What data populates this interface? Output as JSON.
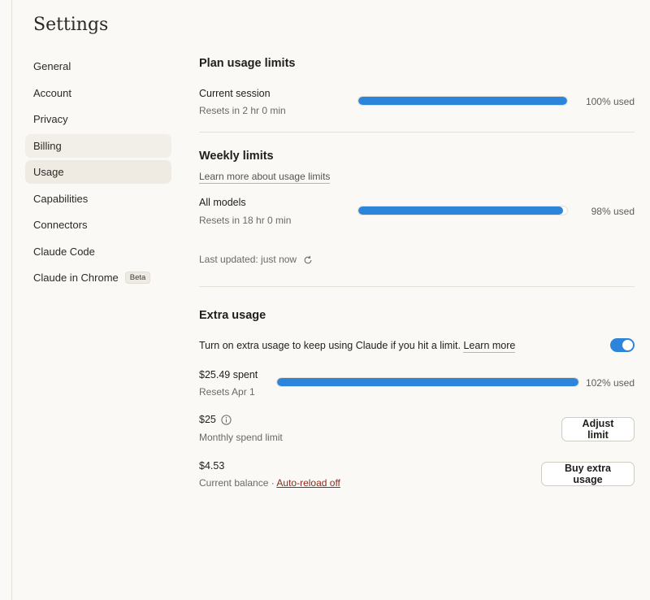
{
  "page": {
    "title": "Settings"
  },
  "sidebar": {
    "items": [
      {
        "label": "General"
      },
      {
        "label": "Account"
      },
      {
        "label": "Privacy"
      },
      {
        "label": "Billing"
      },
      {
        "label": "Usage"
      },
      {
        "label": "Capabilities"
      },
      {
        "label": "Connectors"
      },
      {
        "label": "Claude Code"
      },
      {
        "label": "Claude in Chrome",
        "badge": "Beta"
      }
    ],
    "active": "Usage"
  },
  "plan": {
    "title": "Plan usage limits",
    "session": {
      "label": "Current session",
      "sub": "Resets in 2 hr 0 min",
      "percent": 100,
      "percent_text": "100% used"
    }
  },
  "weekly": {
    "title": "Weekly limits",
    "learn_more": "Learn more about usage limits",
    "all_models": {
      "label": "All models",
      "sub": "Resets in 18 hr 0 min",
      "percent": 98,
      "percent_text": "98% used"
    },
    "last_updated": "Last updated: just now"
  },
  "extra": {
    "title": "Extra usage",
    "description": "Turn on extra usage to keep using Claude if you hit a limit.",
    "learn_more": "Learn more",
    "toggle_on": true,
    "spent": {
      "label": "$25.49 spent",
      "sub": "Resets Apr 1",
      "percent": 102,
      "percent_text": "102% used"
    },
    "limit": {
      "label": "$25",
      "sub": "Monthly spend limit",
      "button": "Adjust limit"
    },
    "balance": {
      "label": "$4.53",
      "sub_prefix": "Current balance · ",
      "auto_reload": "Auto-reload off",
      "button": "Buy extra usage"
    }
  },
  "colors": {
    "accent": "#2c84db",
    "background": "#faf9f5",
    "link_red": "#8c2a1f"
  },
  "icons": {
    "refresh": "refresh-icon",
    "info": "info-icon"
  }
}
